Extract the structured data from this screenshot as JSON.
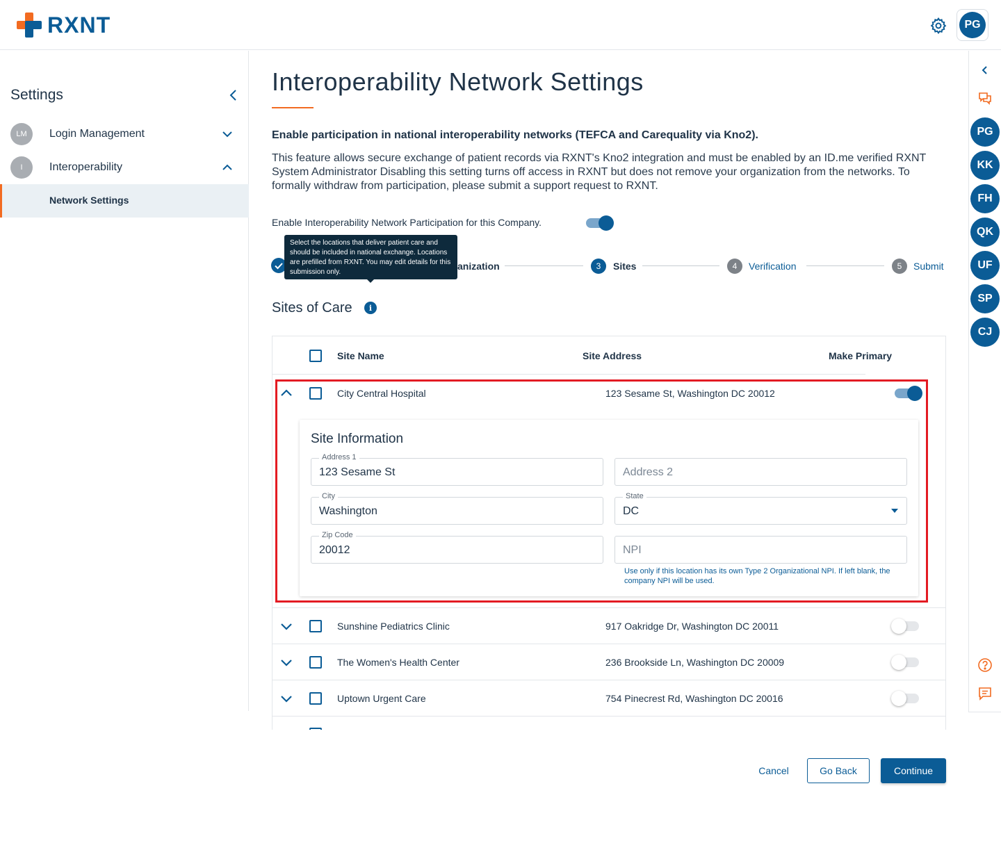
{
  "app": {
    "logo_text": "RXNT",
    "user_initials": "PG"
  },
  "sidebar": {
    "title": "Settings",
    "items": [
      {
        "badge": "LM",
        "label": "Login Management"
      },
      {
        "badge": "I",
        "label": "Interoperability"
      }
    ],
    "subitem": "Network Settings"
  },
  "rail": {
    "users": [
      "PG",
      "KK",
      "FH",
      "QK",
      "UF",
      "SP",
      "CJ"
    ]
  },
  "page": {
    "title": "Interoperability Network Settings",
    "subheading": "Enable participation in national interoperability networks (TEFCA and Carequality via Kno2).",
    "description": "This feature allows secure exchange of patient records via RXNT's Kno2 integration and must be enabled by an ID.me verified RXNT System Administrator Disabling this setting turns off access in RXNT but does not remove your organization from the networks. To formally withdraw from participation, please submit a support request to RXNT.",
    "enable_label": "Enable Interoperability Network Participation for this Company.",
    "enable_on": true
  },
  "stepper": {
    "steps": [
      {
        "num": "1",
        "label": "",
        "state": "done"
      },
      {
        "num": "2",
        "label": "anization",
        "state": "done"
      },
      {
        "num": "3",
        "label": "Sites",
        "state": "active"
      },
      {
        "num": "4",
        "label": "Verification",
        "state": "pending"
      },
      {
        "num": "5",
        "label": "Submit",
        "state": "pending"
      }
    ]
  },
  "tooltip": "Select the locations that deliver patient care and should be included in national exchange. Locations are prefilled from RXNT. You may edit details for this submission only.",
  "sites": {
    "title": "Sites of Care",
    "headers": {
      "name": "Site Name",
      "address": "Site Address",
      "primary": "Make Primary"
    },
    "rows": [
      {
        "name": "City Central Hospital",
        "address": "123 Sesame St, Washington DC 20012",
        "primary": true,
        "expanded": true
      },
      {
        "name": "Sunshine Pediatrics Clinic",
        "address": "917 Oakridge Dr, Washington DC 20011",
        "primary": false,
        "expanded": false
      },
      {
        "name": "The Women's Health Center",
        "address": "236 Brookside Ln, Washington DC 20009",
        "primary": false,
        "expanded": false
      },
      {
        "name": "Uptown Urgent Care",
        "address": "754 Pinecrest Rd, Washington DC 20016",
        "primary": false,
        "expanded": false
      }
    ]
  },
  "site_info": {
    "title": "Site Information",
    "address1_label": "Address 1",
    "address1_value": "123 Sesame St",
    "address2_placeholder": "Address 2",
    "city_label": "City",
    "city_value": "Washington",
    "state_label": "State",
    "state_value": "DC",
    "zip_label": "Zip Code",
    "zip_value": "20012",
    "npi_placeholder": "NPI",
    "npi_help": "Use only if this location has its own Type 2 Organizational NPI. If left blank, the company NPI will be used."
  },
  "actions": {
    "cancel": "Cancel",
    "back": "Go Back",
    "continue": "Continue"
  },
  "colors": {
    "brand_blue": "#0b5c96",
    "brand_orange": "#f26b21",
    "highlight_red": "#e31b23"
  }
}
